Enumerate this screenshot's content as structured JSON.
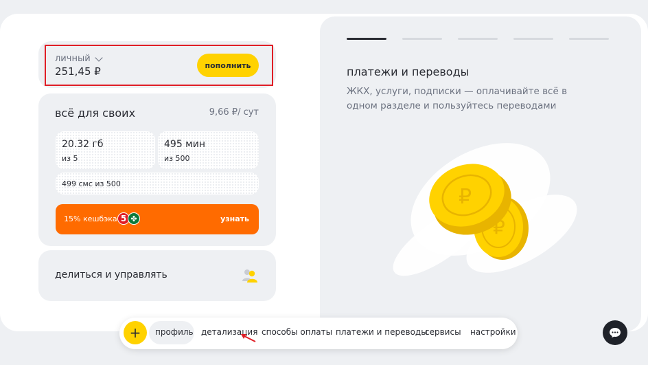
{
  "balance": {
    "account_label": "личный",
    "amount": "251,45 ₽",
    "topup_label": "пополнить"
  },
  "tariff": {
    "title": "всё для своих",
    "price": "9,66 ₽/ сут",
    "data": {
      "value": "20.32 гб",
      "of": "из 5"
    },
    "minutes": {
      "value": "495 мин",
      "of": "из 500"
    },
    "sms": "499 смс из 500",
    "cashback": {
      "label": "15% кешбэка",
      "link": "узнать",
      "logo_text": "5"
    }
  },
  "share": {
    "label": "делиться и управлять",
    "icon": "people-icon"
  },
  "promo": {
    "title": "платежи и переводы",
    "description": "ЖКХ, услуги, подписки — оплачивайте всё в одном разделе и пользуйтесь переводами",
    "slides": 5,
    "active_slide": 1
  },
  "tabs": [
    {
      "label": "профиль"
    },
    {
      "label": "детализация"
    },
    {
      "label": "способы оплаты"
    },
    {
      "label": "платежи и переводы"
    },
    {
      "label": "сервисы"
    },
    {
      "label": "настройки"
    }
  ],
  "colors": {
    "accent": "#ffd200",
    "cashback": "#ff6b00",
    "highlight": "#e01e26"
  }
}
